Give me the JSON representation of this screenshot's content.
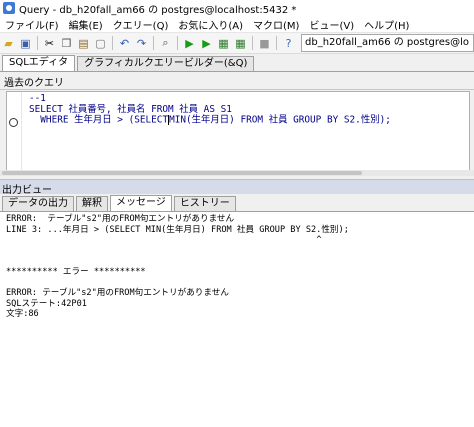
{
  "window": {
    "title": "Query - db_h20fall_am66 の postgres@localhost:5432 *"
  },
  "menu": {
    "items": [
      "ファイル(F)",
      "編集(E)",
      "クエリー(Q)",
      "お気に入り(A)",
      "マクロ(M)",
      "ビュー(V)",
      "ヘルプ(H)"
    ]
  },
  "toolbar": {
    "connection": "db_h20fall_am66 の postgres@lo"
  },
  "query_tabs": {
    "sql_editor": "SQLエディタ",
    "graphical_builder": "グラフィカルクエリービルダー(&Q)"
  },
  "history": {
    "label": "過去のクエリ"
  },
  "editor": {
    "line1": "--1",
    "line2": "SELECT 社員番号, 社員名 FROM 社員 AS S1",
    "line3_a": "  WHERE 生年月日 > (SELECT",
    "line3_b": "MIN(生年月日) FROM 社員 GROUP BY S2.性別);"
  },
  "output_panel": {
    "title": "出力ビュー",
    "tabs": [
      "データの出力",
      "解釈",
      "メッセージ",
      "ヒストリー"
    ],
    "active_tab": "メッセージ"
  },
  "messages": {
    "l1": "ERROR:  テーブル\"s2\"用のFROM句エントリがありません",
    "l2": "LINE 3: ...年月日 > (SELECT MIN(生年月日) FROM 社員 GROUP BY S2.性別);",
    "l3": "                                                            ^",
    "l4": "",
    "l5": "",
    "l6": "********** エラー **********",
    "l7": "",
    "l8": "ERROR: テーブル\"s2\"用のFROM句エントリがありません",
    "l9": "SQLステート:42P01",
    "l10": "文字:86"
  }
}
